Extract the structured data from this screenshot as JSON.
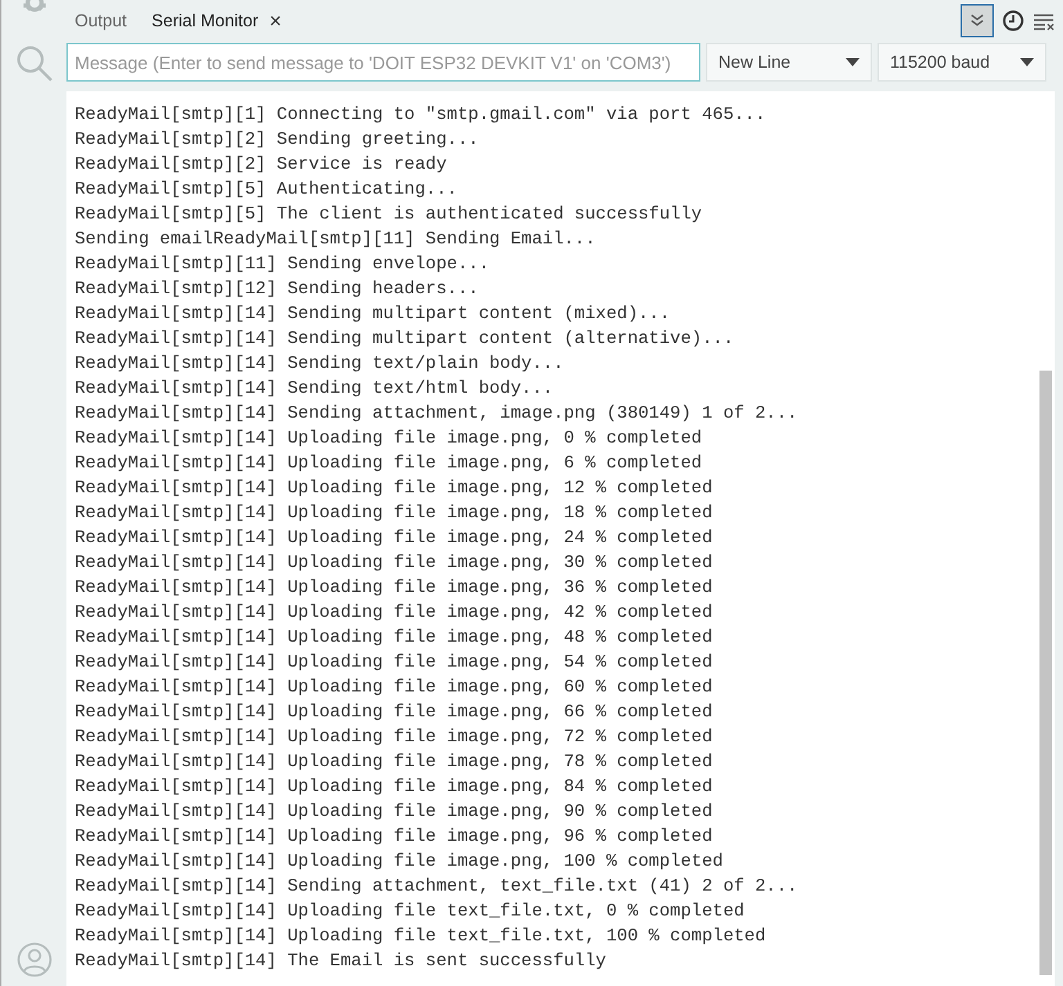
{
  "tabs": [
    {
      "label": "Output",
      "selected": false,
      "closable": false
    },
    {
      "label": "Serial Monitor",
      "selected": true,
      "closable": true,
      "close": "×"
    }
  ],
  "toolbar": {
    "autoscroll_on": true
  },
  "message": {
    "placeholder": "Message (Enter to send message to 'DOIT ESP32 DEVKIT V1' on 'COM3')"
  },
  "line_ending": {
    "value": "New Line"
  },
  "baud": {
    "value": "115200 baud"
  },
  "lines": [
    "ReadyMail[smtp][1] Connecting to \"smtp.gmail.com\" via port 465...",
    "ReadyMail[smtp][2] Sending greeting...",
    "ReadyMail[smtp][2] Service is ready",
    "ReadyMail[smtp][5] Authenticating...",
    "ReadyMail[smtp][5] The client is authenticated successfully",
    "Sending emailReadyMail[smtp][11] Sending Email...",
    "ReadyMail[smtp][11] Sending envelope...",
    "ReadyMail[smtp][12] Sending headers...",
    "ReadyMail[smtp][14] Sending multipart content (mixed)...",
    "ReadyMail[smtp][14] Sending multipart content (alternative)...",
    "ReadyMail[smtp][14] Sending text/plain body...",
    "ReadyMail[smtp][14] Sending text/html body...",
    "ReadyMail[smtp][14] Sending attachment, image.png (380149) 1 of 2...",
    "ReadyMail[smtp][14] Uploading file image.png, 0 % completed",
    "ReadyMail[smtp][14] Uploading file image.png, 6 % completed",
    "ReadyMail[smtp][14] Uploading file image.png, 12 % completed",
    "ReadyMail[smtp][14] Uploading file image.png, 18 % completed",
    "ReadyMail[smtp][14] Uploading file image.png, 24 % completed",
    "ReadyMail[smtp][14] Uploading file image.png, 30 % completed",
    "ReadyMail[smtp][14] Uploading file image.png, 36 % completed",
    "ReadyMail[smtp][14] Uploading file image.png, 42 % completed",
    "ReadyMail[smtp][14] Uploading file image.png, 48 % completed",
    "ReadyMail[smtp][14] Uploading file image.png, 54 % completed",
    "ReadyMail[smtp][14] Uploading file image.png, 60 % completed",
    "ReadyMail[smtp][14] Uploading file image.png, 66 % completed",
    "ReadyMail[smtp][14] Uploading file image.png, 72 % completed",
    "ReadyMail[smtp][14] Uploading file image.png, 78 % completed",
    "ReadyMail[smtp][14] Uploading file image.png, 84 % completed",
    "ReadyMail[smtp][14] Uploading file image.png, 90 % completed",
    "ReadyMail[smtp][14] Uploading file image.png, 96 % completed",
    "ReadyMail[smtp][14] Uploading file image.png, 100 % completed",
    "ReadyMail[smtp][14] Sending attachment, text_file.txt (41) 2 of 2...",
    "ReadyMail[smtp][14] Uploading file text_file.txt, 0 % completed",
    "ReadyMail[smtp][14] Uploading file text_file.txt, 100 % completed",
    "ReadyMail[smtp][14] The Email is sent successfully"
  ]
}
